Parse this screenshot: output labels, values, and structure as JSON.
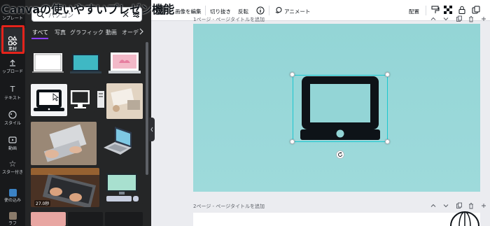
{
  "overlay_title": "Canvaの使いやすいプレゼン機能",
  "rail": {
    "items": [
      {
        "label": "ンプレート",
        "icon": "template-icon"
      },
      {
        "label": "素材",
        "icon": "elements-icon"
      },
      {
        "label": "ップロード",
        "icon": "upload-icon"
      },
      {
        "label": "テキスト",
        "icon": "text-icon"
      },
      {
        "label": "スタイル",
        "icon": "style-icon"
      },
      {
        "label": "動画",
        "icon": "video-icon"
      },
      {
        "label": "スター付き",
        "icon": "star-icon"
      },
      {
        "label": "使の込み",
        "icon": "embed-icon"
      },
      {
        "label": "ラフ",
        "icon": "draw-icon"
      }
    ]
  },
  "search": {
    "value": "パソコン"
  },
  "tabs": [
    "すべて",
    "写真",
    "グラフィック",
    "動画",
    "オーデ"
  ],
  "results": {
    "duration": "27.0秒"
  },
  "toolbar": {
    "edit_image": "画像を編集",
    "crop": "切り抜き",
    "flip": "反転",
    "animate": "アニメート",
    "position": "配置"
  },
  "canvas": {
    "page1_title": "1ページ - ページタイトルを追加",
    "page2_title": "2ページ - ページタイトルを追加"
  },
  "colors": {
    "accent": "#8b3dff",
    "selection": "#1cc7d0",
    "page_bg": "#93d5d6",
    "highlight": "#e4231b"
  }
}
